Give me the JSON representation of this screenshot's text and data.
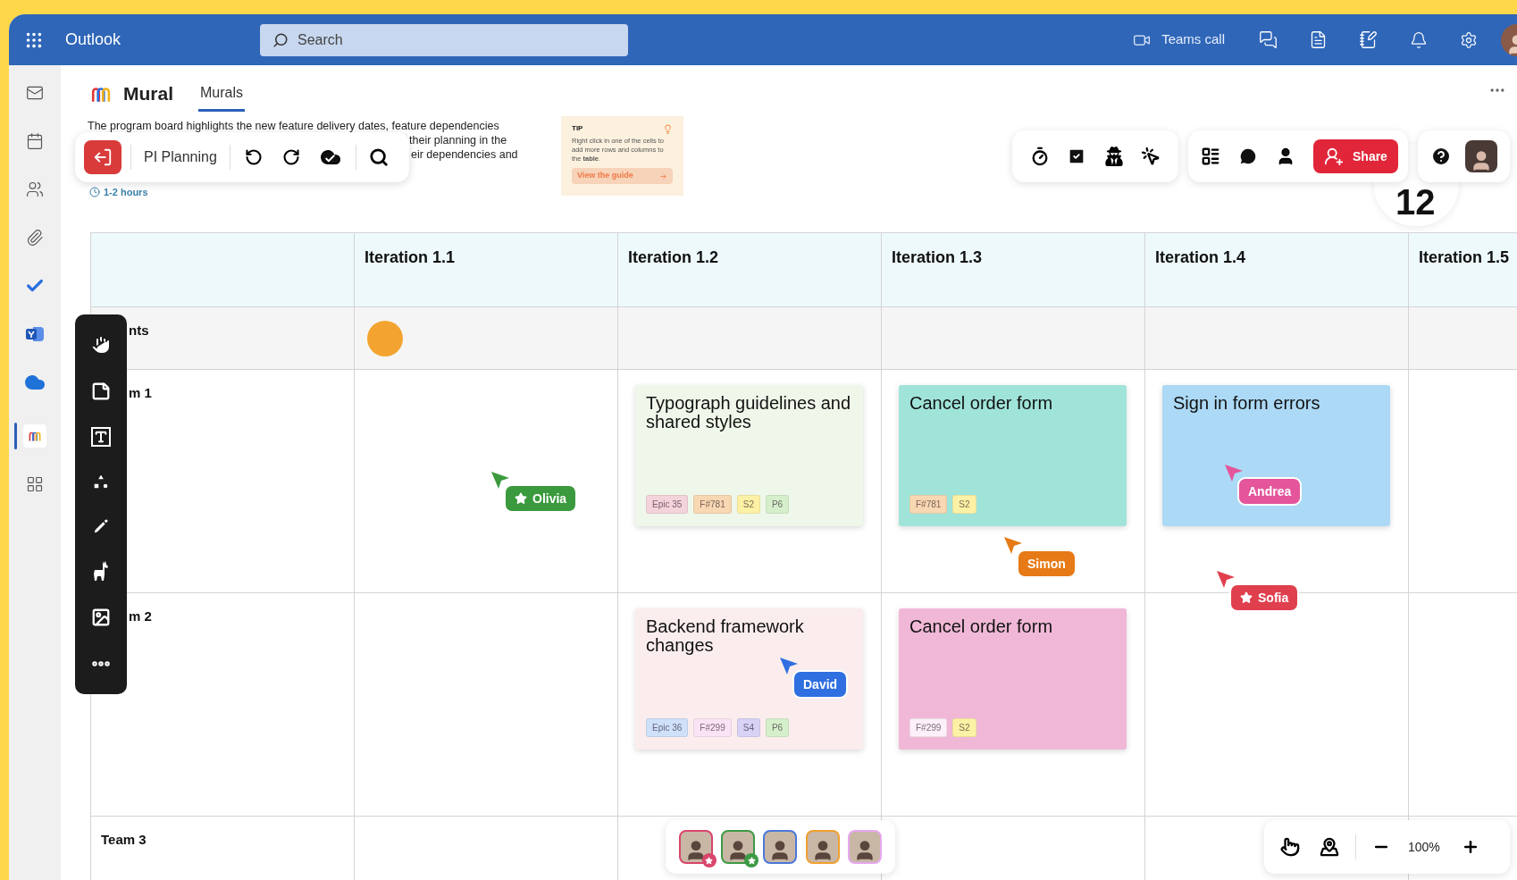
{
  "outlook": {
    "app_name": "Outlook",
    "search": {
      "placeholder": "Search"
    },
    "teams_call": "Teams call"
  },
  "rail": [
    {
      "kind": "mail",
      "selected": false
    },
    {
      "kind": "calendar",
      "selected": false
    },
    {
      "kind": "people",
      "selected": false
    },
    {
      "kind": "attach",
      "selected": false
    },
    {
      "kind": "todo",
      "selected": false
    },
    {
      "kind": "engage",
      "selected": false
    },
    {
      "kind": "onedrive",
      "selected": false
    },
    {
      "kind": "mural",
      "selected": true
    },
    {
      "kind": "apps",
      "selected": false
    }
  ],
  "mural": {
    "title": "Mural",
    "tabs": [
      {
        "label": "Murals",
        "selected": true
      }
    ]
  },
  "description_lines": [
    "The program board highlights the new feature delivery dates, feature dependencies",
    "their planning in the",
    "eir dependencies and"
  ],
  "duration": "1-2 hours",
  "board_toolbar": {
    "name": "PI Planning"
  },
  "tip": {
    "label": "TIP",
    "text": "Right click in one of the cells to add more rows and columns to the **table**.",
    "link": "View the guide"
  },
  "share": "Share",
  "step_number": "12",
  "board": {
    "columns": [
      "Iteration 1.1",
      "Iteration 1.2",
      "Iteration 1.3",
      "Iteration 1.4",
      "Iteration 1.5"
    ],
    "rows": [
      {
        "label": "nts",
        "cells": [
          {
            "kind": "milestone"
          },
          {
            "kind": "empty"
          },
          {
            "kind": "empty"
          },
          {
            "kind": "empty"
          },
          {
            "kind": "empty"
          }
        ]
      },
      {
        "label": "m 1",
        "cells": [
          {
            "kind": "empty"
          },
          {
            "kind": "card",
            "title": "Typograph guidelines and shared styles",
            "color": "#eff7ea",
            "tags": [
              {
                "label": "Epic 35",
                "color": "#f4d3db"
              },
              {
                "label": "F#781",
                "color": "#f7d8b3"
              },
              {
                "label": "S2",
                "color": "#fdf1a6"
              },
              {
                "label": "P6",
                "color": "#d5efcb"
              }
            ]
          },
          {
            "kind": "card",
            "title": "Cancel order form",
            "color": "#a0e4d9",
            "tags": [
              {
                "label": "F#781",
                "color": "#f7d8b3"
              },
              {
                "label": "S2",
                "color": "#fdf1a6"
              }
            ]
          },
          {
            "kind": "card",
            "title": "Sign in form errors",
            "color": "#acd9f5"
          },
          {
            "kind": "empty"
          }
        ]
      },
      {
        "label": "m 2",
        "cells": [
          {
            "kind": "empty"
          },
          {
            "kind": "card",
            "title": "Backend framework changes",
            "color": "#fbeded",
            "tags": [
              {
                "label": "Epic 36",
                "color": "#cfe0fa"
              },
              {
                "label": "F#299",
                "color": "#fbe3f6"
              },
              {
                "label": "S4",
                "color": "#d8d3f6"
              },
              {
                "label": "P6",
                "color": "#d5efcb"
              }
            ]
          },
          {
            "kind": "card",
            "title": "Cancel order form",
            "color": "#f0b8d6",
            "tags": [
              {
                "label": "F#299",
                "color": "#fdf0f8"
              },
              {
                "label": "S2",
                "color": "#fdf1a6"
              }
            ]
          },
          {
            "kind": "empty"
          },
          {
            "kind": "empty"
          }
        ]
      },
      {
        "label": "Team 3",
        "cells": [
          {
            "kind": "empty"
          },
          {
            "kind": "empty"
          },
          {
            "kind": "empty"
          },
          {
            "kind": "empty"
          }
        ]
      }
    ]
  },
  "cursors": [
    {
      "name": "Olivia",
      "color": "#3b9a3d",
      "starred": true
    },
    {
      "name": "Simon",
      "color": "#e67a16",
      "starred": false
    },
    {
      "name": "Andrea",
      "color": "#e4559b",
      "starred": false
    },
    {
      "name": "Sofia",
      "color": "#e0404e",
      "starred": true
    },
    {
      "name": "David",
      "color": "#2f6fe0",
      "starred": false
    }
  ],
  "collaborators": [
    {
      "color": "#d9456b",
      "starred": true
    },
    {
      "color": "#3d9a45",
      "starred": true
    },
    {
      "color": "#4a78d8",
      "starred": false
    },
    {
      "color": "#f0a030",
      "starred": false
    },
    {
      "color": "#e6a8ef",
      "starred": false
    }
  ],
  "zoom": "100%"
}
